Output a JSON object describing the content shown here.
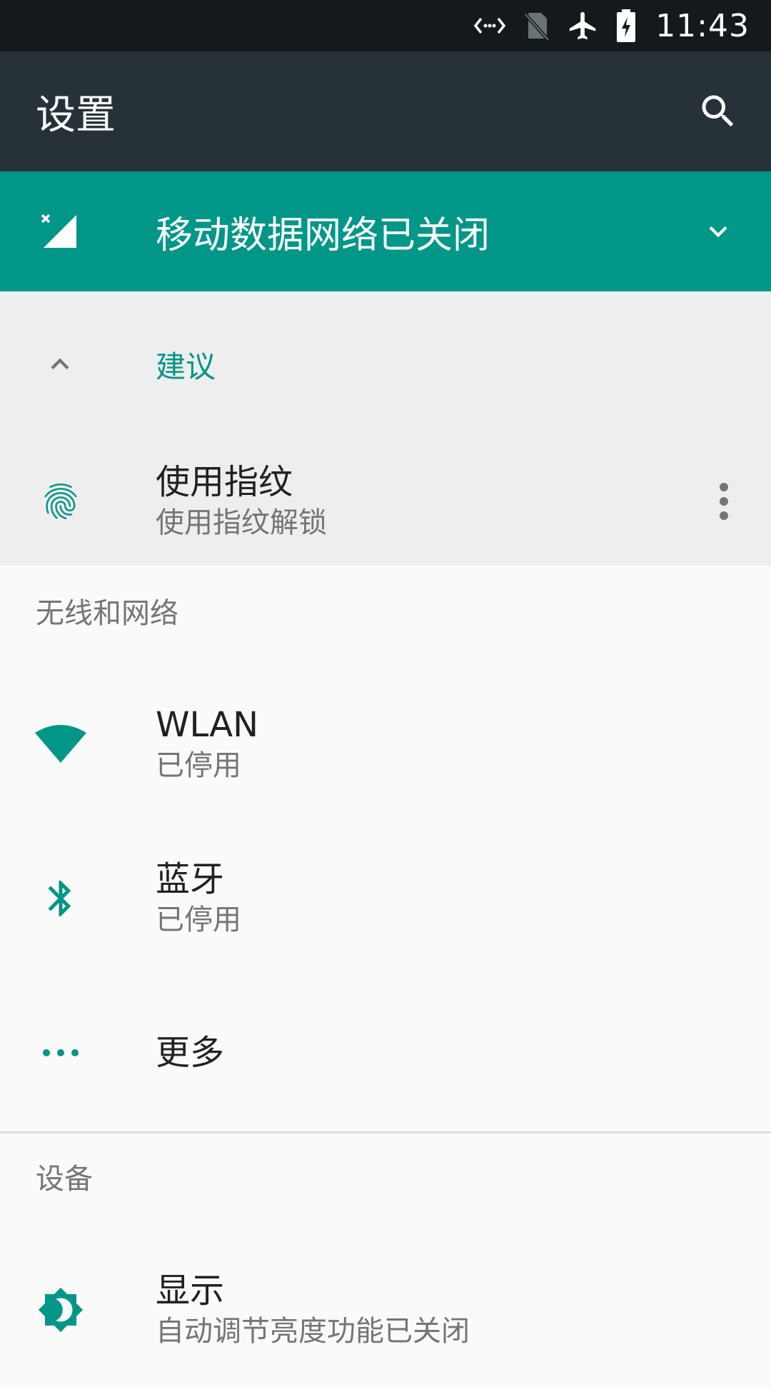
{
  "status_bar": {
    "time": "11:43",
    "icons": [
      "data-saver-icon",
      "no-sim-icon",
      "airplane-icon",
      "battery-charging-icon"
    ]
  },
  "app_bar": {
    "title": "设置",
    "search_icon": "search-icon"
  },
  "condition": {
    "text": "移动数据网络已关闭",
    "icon": "cellular-off-icon",
    "expand_icon": "chevron-down-icon"
  },
  "suggestions": {
    "label": "建议",
    "collapse_icon": "chevron-up-icon",
    "items": [
      {
        "title": "使用指纹",
        "subtitle": "使用指纹解锁",
        "icon": "fingerprint-icon"
      }
    ]
  },
  "sections": [
    {
      "header": "无线和网络",
      "items": [
        {
          "title": "WLAN",
          "subtitle": "已停用",
          "icon": "wifi-icon"
        },
        {
          "title": "蓝牙",
          "subtitle": "已停用",
          "icon": "bluetooth-icon"
        },
        {
          "title": "更多",
          "icon": "more-horiz-icon"
        }
      ]
    },
    {
      "header": "设备",
      "items": [
        {
          "title": "显示",
          "subtitle": "自动调节亮度功能已关闭",
          "icon": "brightness-icon"
        }
      ]
    }
  ],
  "colors": {
    "accent": "#009688",
    "app_bar": "#263238",
    "status_bar": "#14191c",
    "background": "#fafafa",
    "suggestion_bg": "#eeeeee"
  }
}
